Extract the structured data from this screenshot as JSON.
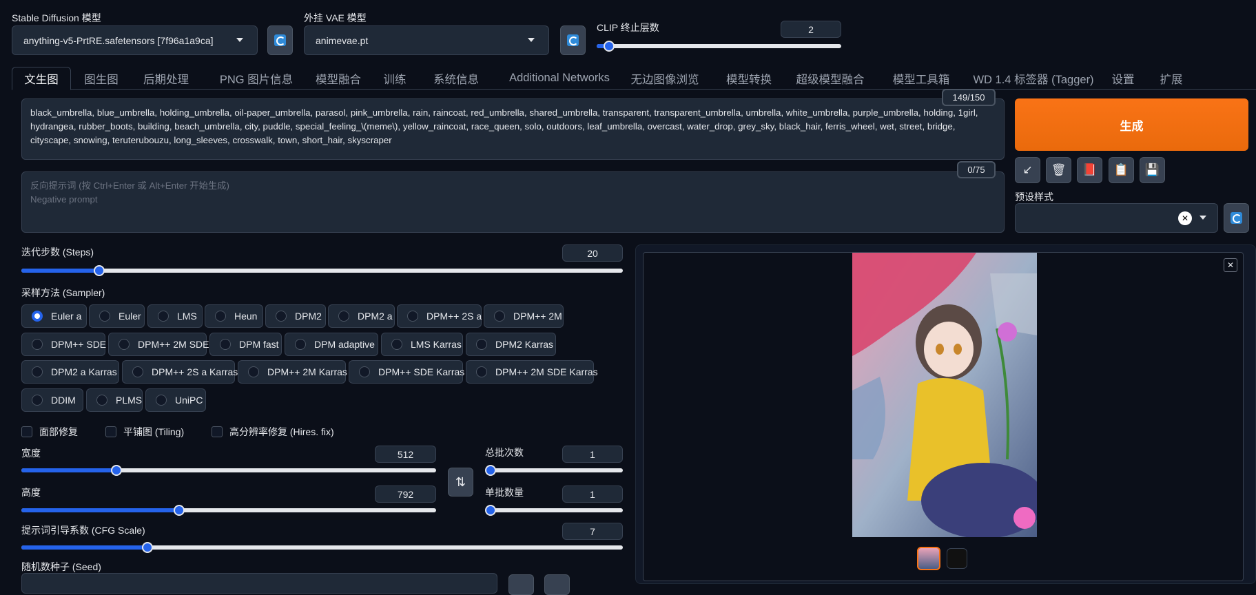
{
  "model": {
    "label": "Stable Diffusion 模型",
    "value": "anything-v5-PrtRE.safetensors [7f96a1a9ca]"
  },
  "vae": {
    "label": "外挂 VAE 模型",
    "value": "animevae.pt"
  },
  "clip": {
    "label": "CLIP 终止层数",
    "value": "2",
    "fraction": 0.05
  },
  "tabs": [
    "文生图",
    "图生图",
    "后期处理",
    "PNG 图片信息",
    "模型融合",
    "训练",
    "系统信息",
    "Additional Networks",
    "无边图像浏览",
    "模型转换",
    "超级模型融合",
    "模型工具箱",
    "WD 1.4 标签器 (Tagger)",
    "设置",
    "扩展"
  ],
  "prompt": {
    "text": "black_umbrella, blue_umbrella, holding_umbrella, oil-paper_umbrella, parasol, pink_umbrella, rain, raincoat, red_umbrella, shared_umbrella, transparent, transparent_umbrella, umbrella, white_umbrella, purple_umbrella, holding, 1girl, hydrangea, rubber_boots, building, beach_umbrella, city, puddle, special_feeling_\\(meme\\), yellow_raincoat, race_queen, solo, outdoors, leaf_umbrella, overcast, water_drop, grey_sky, black_hair, ferris_wheel, wet, street, bridge, cityscape, snowing, teruterubouzu, long_sleeves, crosswalk, town, short_hair, skyscraper",
    "counter": "149/150"
  },
  "negative": {
    "placeholder_1": "反向提示词 (按 Ctrl+Enter 或 Alt+Enter 开始生成)",
    "placeholder_2": "Negative prompt",
    "counter": "0/75"
  },
  "generate_label": "生成",
  "tools": [
    "↙",
    "🗑",
    "📕",
    "📋",
    "💾"
  ],
  "styles_label": "预设样式",
  "steps": {
    "label": "迭代步数 (Steps)",
    "value": "20",
    "fraction": 0.13
  },
  "sampler": {
    "label": "采样方法 (Sampler)",
    "selected": "Euler a",
    "options": [
      "Euler a",
      "Euler",
      "LMS",
      "Heun",
      "DPM2",
      "DPM2 a",
      "DPM++ 2S a",
      "DPM++ 2M",
      "DPM++ SDE",
      "DPM++ 2M SDE",
      "DPM fast",
      "DPM adaptive",
      "LMS Karras",
      "DPM2 Karras",
      "DPM2 a Karras",
      "DPM++ 2S a Karras",
      "DPM++ 2M Karras",
      "DPM++ SDE Karras",
      "DPM++ 2M SDE Karras",
      "DDIM",
      "PLMS",
      "UniPC"
    ]
  },
  "checks": [
    "面部修复",
    "平铺图 (Tiling)",
    "高分辨率修复 (Hires. fix)"
  ],
  "width": {
    "label": "宽度",
    "value": "512",
    "fraction": 0.23
  },
  "height": {
    "label": "高度",
    "value": "792",
    "fraction": 0.38
  },
  "batch_count": {
    "label": "总批次数",
    "value": "1",
    "fraction": 0.0
  },
  "batch_size": {
    "label": "单批数量",
    "value": "1",
    "fraction": 0.0
  },
  "cfg": {
    "label": "提示词引导系数 (CFG Scale)",
    "value": "7",
    "fraction": 0.21
  },
  "seed": {
    "label": "随机数种子 (Seed)"
  },
  "swap_icon": "⇅",
  "close_icon": "✕"
}
